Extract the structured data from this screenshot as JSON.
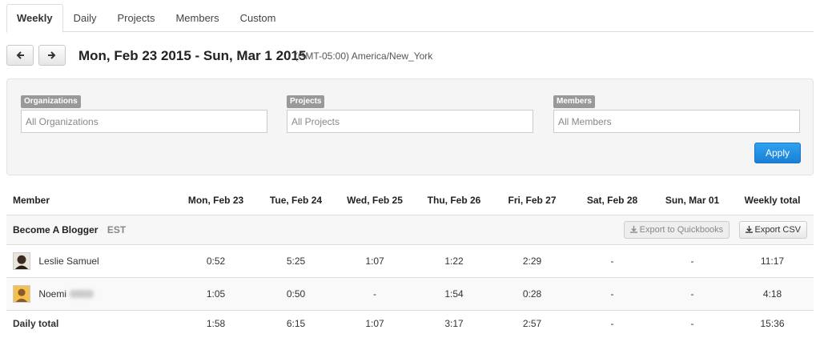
{
  "tabs": [
    {
      "label": "Weekly",
      "active": true
    },
    {
      "label": "Daily"
    },
    {
      "label": "Projects"
    },
    {
      "label": "Members"
    },
    {
      "label": "Custom"
    }
  ],
  "date_range": {
    "title": "Mon, Feb 23 2015 - Sun, Mar 1 2015",
    "timezone": "(GMT-05:00) America/New_York"
  },
  "filters": {
    "organizations": {
      "label": "Organizations",
      "placeholder": "All Organizations"
    },
    "projects": {
      "label": "Projects",
      "placeholder": "All Projects"
    },
    "members": {
      "label": "Members",
      "placeholder": "All Members"
    },
    "apply_label": "Apply"
  },
  "table": {
    "headers": [
      "Member",
      "Mon, Feb 23",
      "Tue, Feb 24",
      "Wed, Feb 25",
      "Thu, Feb 26",
      "Fri, Feb 27",
      "Sat, Feb 28",
      "Sun, Mar 01",
      "Weekly total"
    ],
    "group": {
      "name": "Become A Blogger",
      "timezone": "EST",
      "export_quickbooks_label": "Export to Quickbooks",
      "export_csv_label": "Export CSV"
    },
    "rows": [
      {
        "name": "Leslie Samuel",
        "days": [
          "0:52",
          "5:25",
          "1:07",
          "1:22",
          "2:29",
          "-",
          "-"
        ],
        "total": "11:17"
      },
      {
        "name": "Noemi",
        "days": [
          "1:05",
          "0:50",
          "-",
          "1:54",
          "0:28",
          "-",
          "-"
        ],
        "total": "4:18"
      }
    ],
    "daily_total": {
      "label": "Daily total",
      "days": [
        "1:58",
        "6:15",
        "1:07",
        "3:17",
        "2:57",
        "-",
        "-"
      ],
      "total": "15:36"
    }
  },
  "colors": {
    "accent": "#1f8ce0",
    "panel_bg": "#f5f5f5"
  }
}
